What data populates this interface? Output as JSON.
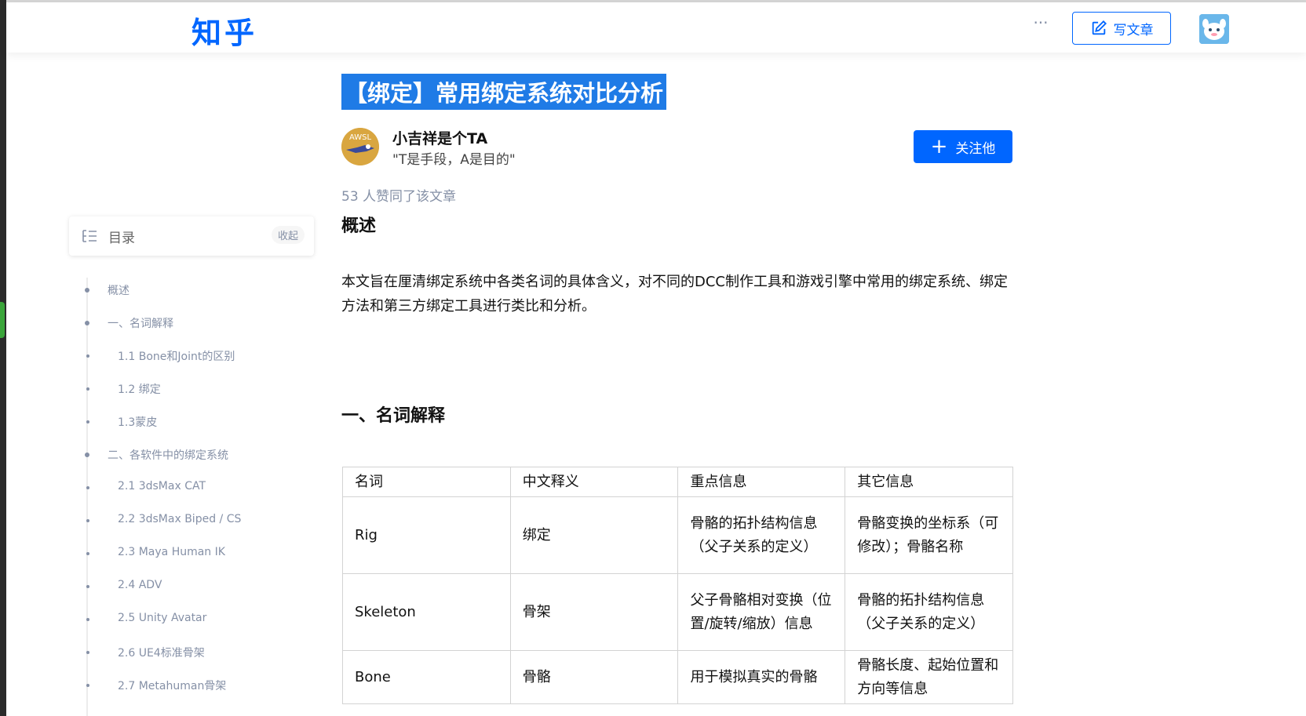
{
  "header": {
    "logo": "知乎",
    "more": "···",
    "write_label": "写文章"
  },
  "article": {
    "title": "【绑定】常用绑定系统对比分析",
    "author_name": "小吉祥是个TA",
    "author_avatar_text": "AWSL",
    "author_bio": "\"T是手段，A是目的\"",
    "follow_label": "关注他",
    "likes": "53 人赞同了该文章",
    "section_overview": "概述",
    "overview_text": "本文旨在厘清绑定系统中各类名词的具体含义，对不同的DCC制作工具和游戏引擎中常用的绑定系统、绑定方法和第三方绑定工具进行类比和分析。",
    "section_terms": "一、名词解释"
  },
  "toc": {
    "label": "目录",
    "collapse": "收起",
    "items": [
      {
        "label": "概述",
        "level": 1
      },
      {
        "label": "一、名词解释",
        "level": 1
      },
      {
        "label": "1.1 Bone和Joint的区别",
        "level": 2
      },
      {
        "label": "1.2 绑定",
        "level": 2
      },
      {
        "label": "1.3蒙皮",
        "level": 2
      },
      {
        "label": "二、各软件中的绑定系统",
        "level": 1
      },
      {
        "label": "2.1 3dsMax CAT",
        "level": 2
      },
      {
        "label": "2.2 3dsMax Biped / CS",
        "level": 2
      },
      {
        "label": "2.3 Maya Human IK",
        "level": 2
      },
      {
        "label": "2.4 ADV",
        "level": 2
      },
      {
        "label": "2.5 Unity Avatar",
        "level": 2
      },
      {
        "label": "2.6 UE4标准骨架",
        "level": 2
      },
      {
        "label": "2.7 Metahuman骨架",
        "level": 2
      }
    ]
  },
  "table": {
    "headers": [
      "名词",
      "中文释义",
      "重点信息",
      "其它信息"
    ],
    "rows": [
      [
        "Rig",
        "绑定",
        "骨骼的拓扑结构信息（父子关系的定义）",
        "骨骼变换的坐标系（可修改）；骨骼名称"
      ],
      [
        "Skeleton",
        "骨架",
        "父子骨骼相对变换（位置/旋转/缩放）信息",
        "骨骼的拓扑结构信息（父子关系的定义）"
      ],
      [
        "Bone",
        "骨骼",
        "用于模拟真实的骨骼",
        "骨骼长度、起始位置和方向等信息"
      ]
    ]
  }
}
